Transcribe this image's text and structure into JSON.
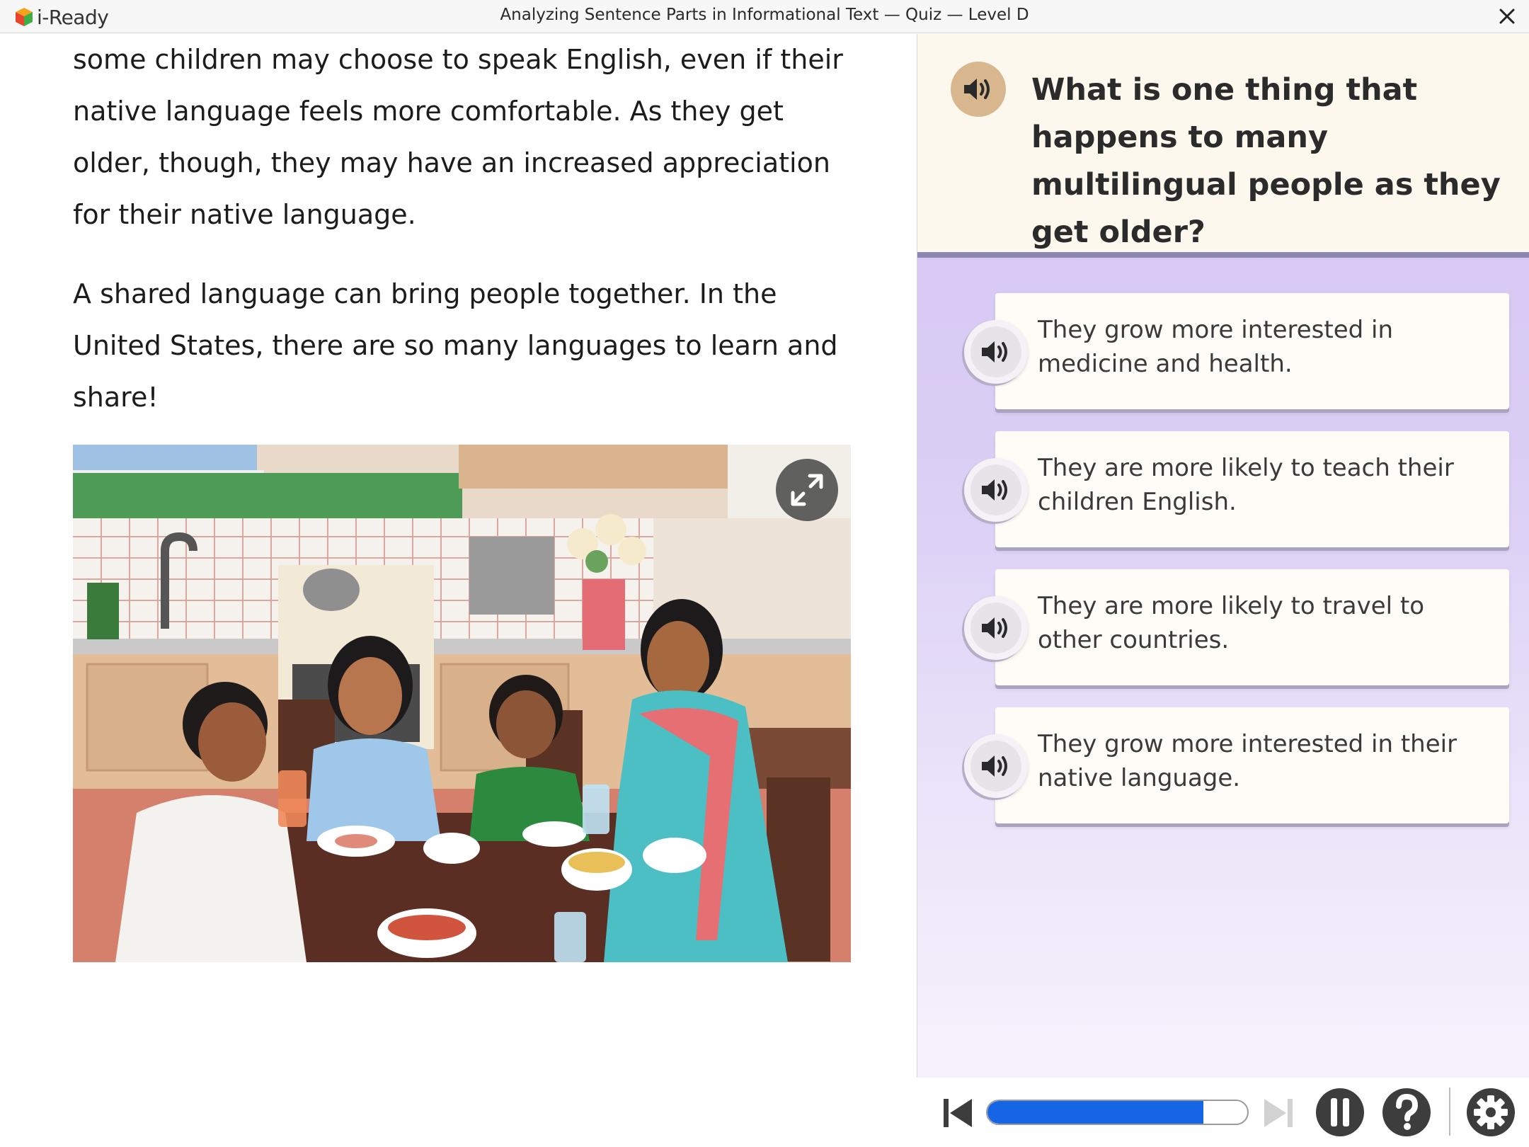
{
  "app": {
    "logo_text": "i-Ready",
    "window_title": "Analyzing Sentence Parts in Informational Text — Quiz — Level D"
  },
  "passage": {
    "paragraph1": "some children may choose to speak English, even if their native language feels more comfortable. As they get older, though, they may have an increased appreciation for their native language.",
    "paragraph2": "A shared language can bring people together. In the United States, there are so many languages to learn and share!"
  },
  "question": {
    "text": "What is one thing that happens to many multilingual people as they get older?"
  },
  "options": [
    {
      "text": "They grow more interested in medicine and health."
    },
    {
      "text": "They are more likely to teach their children English."
    },
    {
      "text": "They are more likely to travel to other countries."
    },
    {
      "text": "They grow more interested in their native language."
    }
  ],
  "controls": {
    "progress_fraction": 0.83
  },
  "colors": {
    "accent_blue": "#1565e6",
    "question_header_bg": "#fcf8ee",
    "panel_purple": "#d2c2f2",
    "audio_tan": "#d8b68e",
    "control_dark": "#3d3d3d"
  },
  "icons": {
    "logo": "cube-logo-icon",
    "close": "close-icon",
    "expand": "expand-icon",
    "audio": "speaker-icon",
    "back": "skip-back-icon",
    "forward": "skip-forward-icon",
    "pause": "pause-icon",
    "help": "help-icon",
    "settings": "gear-icon"
  }
}
